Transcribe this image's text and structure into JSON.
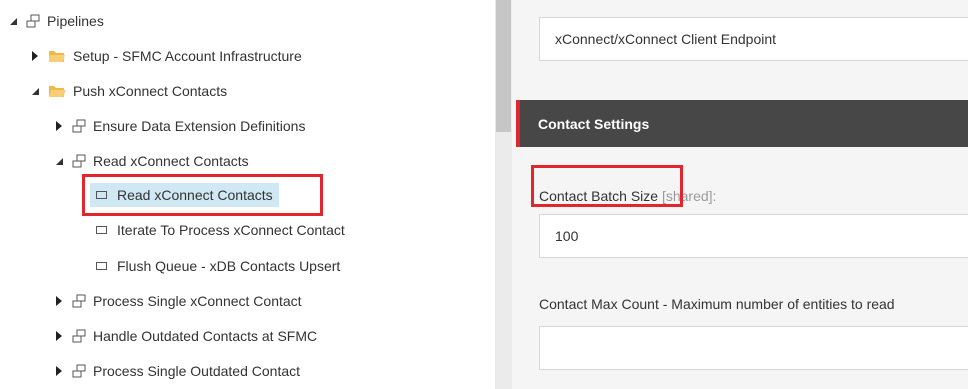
{
  "tree": {
    "root": {
      "label": "Pipelines"
    },
    "items": [
      {
        "label": "Setup - SFMC Account Infrastructure"
      },
      {
        "label": "Push xConnect Contacts"
      },
      {
        "label": "Ensure Data Extension Definitions"
      },
      {
        "label": "Read xConnect Contacts"
      },
      {
        "label": "Read xConnect Contacts"
      },
      {
        "label": "Iterate To Process xConnect Contact"
      },
      {
        "label": "Flush Queue - xDB Contacts Upsert"
      },
      {
        "label": "Process Single xConnect Contact"
      },
      {
        "label": "Handle Outdated Contacts at SFMC"
      },
      {
        "label": "Process Single Outdated Contact"
      }
    ],
    "folder_color": "#f2b649",
    "highlight_color": "#e2262d"
  },
  "panel": {
    "endpoint_value": "xConnect/xConnect Client Endpoint",
    "section_title": "Contact Settings",
    "batch_label": "Contact Batch Size",
    "batch_shared": " [shared]:",
    "batch_value": "100",
    "max_count_label": "Contact Max Count - Maximum number of entities to read",
    "max_count_value": ""
  }
}
